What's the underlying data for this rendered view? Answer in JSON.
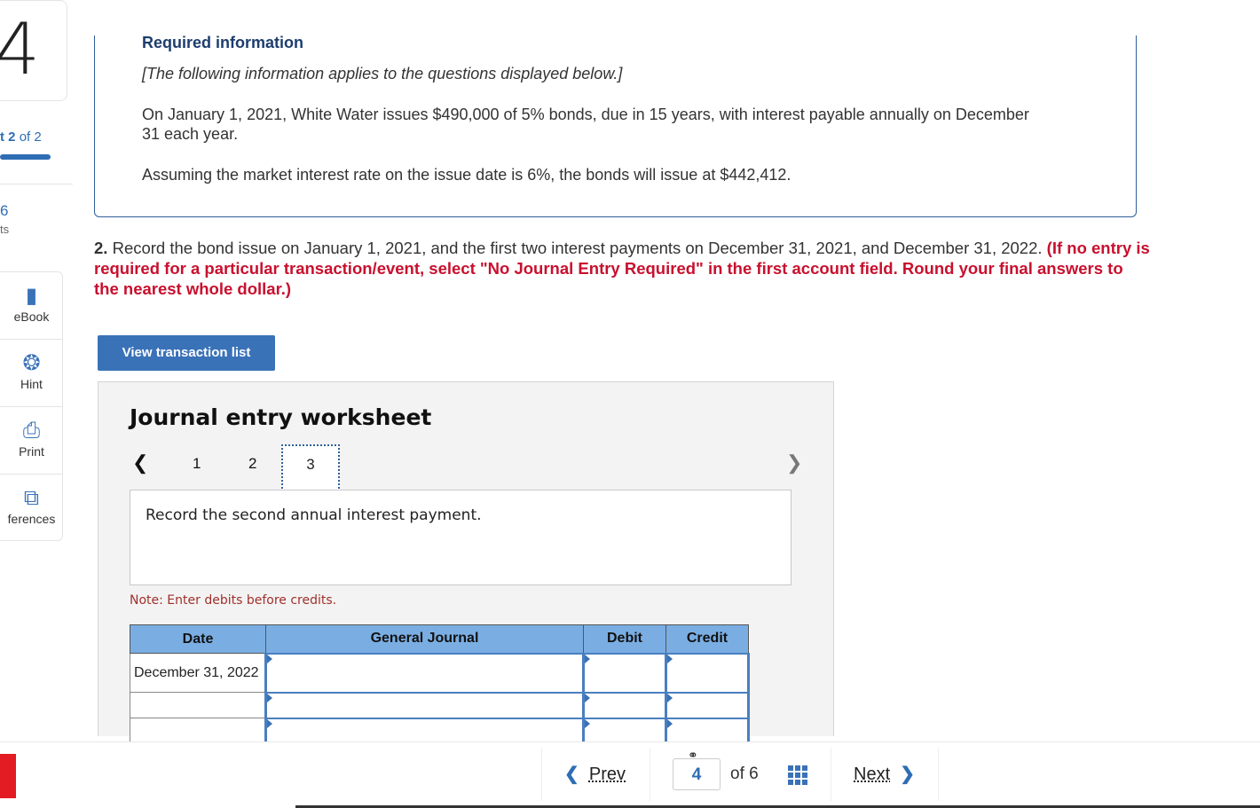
{
  "sidebar": {
    "question_number": "4",
    "part_prefix": "t",
    "part_current": "2",
    "part_of": "of 2",
    "points_value": "6",
    "points_label": "ts",
    "tools": [
      {
        "label": "eBook",
        "icon": "book-icon"
      },
      {
        "label": "Hint",
        "icon": "lifebuoy-icon"
      },
      {
        "label": "Print",
        "icon": "printer-icon"
      },
      {
        "label": "ferences",
        "icon": "references-icon"
      }
    ]
  },
  "info": {
    "title": "Required information",
    "intro": "[The following information applies to the questions displayed below.]",
    "p1": "On January 1, 2021, White Water issues $490,000 of 5% bonds, due in 15 years, with interest payable annually on December 31 each year.",
    "p2": "Assuming the market interest rate on the issue date is 6%, the bonds will issue at $442,412."
  },
  "question": {
    "number": "2.",
    "text": " Record the bond issue on January 1, 2021, and the first two interest payments on December 31, 2021, and December 31, 2022. ",
    "instruction": "(If no entry is required for a particular transaction/event, select \"No Journal Entry Required\" in the first account field. Round your final answers to the nearest whole dollar.)"
  },
  "view_button": "View transaction list",
  "worksheet": {
    "title": "Journal entry worksheet",
    "tabs": [
      "1",
      "2",
      "3"
    ],
    "active_tab": "3",
    "description": "Record the second annual interest payment.",
    "note": "Note: Enter debits before credits.",
    "columns": [
      "Date",
      "General Journal",
      "Debit",
      "Credit"
    ],
    "rows": [
      {
        "date": "December 31, 2022",
        "account": "",
        "debit": "",
        "credit": ""
      },
      {
        "date": "",
        "account": "",
        "debit": "",
        "credit": ""
      },
      {
        "date": "",
        "account": "",
        "debit": "",
        "credit": ""
      }
    ]
  },
  "footer": {
    "prev": "Prev",
    "current_page": "4",
    "of_label": "of 6",
    "next": "Next"
  },
  "colors": {
    "accent": "#3a72b8",
    "header": "#7aaee3",
    "instruction": "#c8102e",
    "logo": "#e31b23"
  }
}
